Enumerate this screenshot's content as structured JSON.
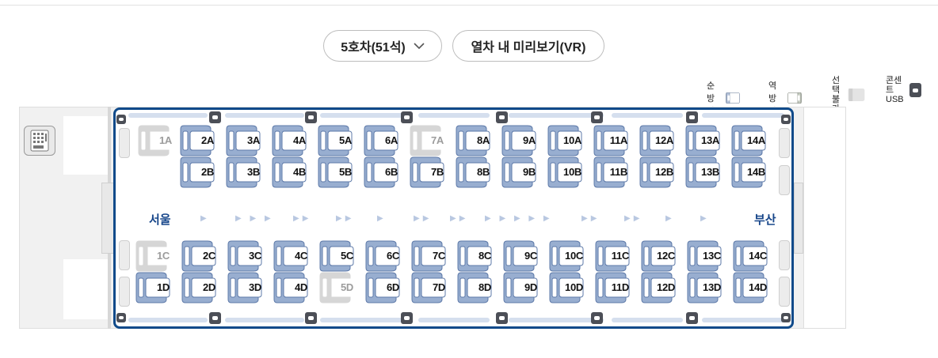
{
  "header": {
    "car_select_label": "5호차(51석)",
    "vr_label": "열차 내 미리보기(VR)"
  },
  "legend": {
    "forward": "순방향",
    "reverse": "역방향",
    "unavailable_1": "선택",
    "unavailable_2": "불가",
    "outlet_1": "콘센트",
    "outlet_2": "USB"
  },
  "stations": {
    "from": "서울",
    "to": "부산"
  },
  "seats": {
    "rowA": [
      "1A",
      "2A",
      "3A",
      "4A",
      "5A",
      "6A",
      "7A",
      "8A",
      "9A",
      "10A",
      "11A",
      "12A",
      "13A",
      "14A"
    ],
    "rowB": [
      "2B",
      "3B",
      "4B",
      "5B",
      "6B",
      "7B",
      "8B",
      "9B",
      "10B",
      "11B",
      "12B",
      "13B",
      "14B"
    ],
    "rowC": [
      "1C",
      "2C",
      "3C",
      "4C",
      "5C",
      "6C",
      "7C",
      "8C",
      "9C",
      "10C",
      "11C",
      "12C",
      "13C",
      "14C"
    ],
    "rowD": [
      "1D",
      "2D",
      "3D",
      "4D",
      "5D",
      "6D",
      "7D",
      "8D",
      "9D",
      "10D",
      "11D",
      "12D",
      "13D",
      "14D"
    ],
    "unavailable": [
      "1A",
      "7A",
      "1C",
      "5D"
    ]
  },
  "colors": {
    "seat": "#98aed0",
    "seat_border": "#5d79a8",
    "accent": "#0f4a8a",
    "disabled": "#d6d6d6"
  }
}
